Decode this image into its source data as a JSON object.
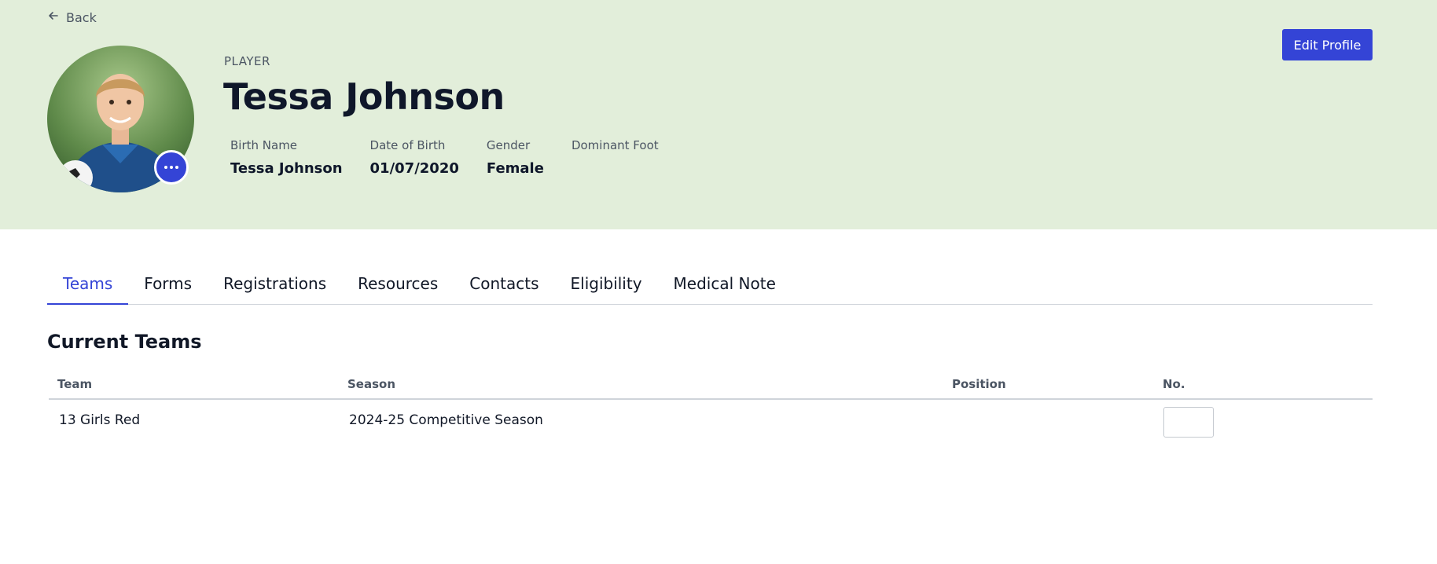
{
  "nav": {
    "back_label": "Back"
  },
  "profile": {
    "role": "PLAYER",
    "name": "Tessa Johnson",
    "edit_label": "Edit Profile",
    "facts": [
      {
        "label": "Birth Name",
        "value": "Tessa Johnson"
      },
      {
        "label": "Date of Birth",
        "value": "01/07/2020"
      },
      {
        "label": "Gender",
        "value": "Female"
      },
      {
        "label": "Dominant Foot",
        "value": ""
      }
    ]
  },
  "tabs": [
    {
      "label": "Teams",
      "active": true
    },
    {
      "label": "Forms"
    },
    {
      "label": "Registrations"
    },
    {
      "label": "Resources"
    },
    {
      "label": "Contacts"
    },
    {
      "label": "Eligibility"
    },
    {
      "label": "Medical Note"
    }
  ],
  "current_teams": {
    "title": "Current Teams",
    "headers": {
      "team": "Team",
      "season": "Season",
      "position": "Position",
      "number": "No."
    },
    "rows": [
      {
        "team": "13 Girls Red",
        "season": "2024-25 Competitive Season",
        "position": "",
        "number": ""
      }
    ]
  },
  "colors": {
    "accent": "#3444d6",
    "hero_bg": "#e2eeda"
  },
  "icons": {
    "back": "arrow-left-icon",
    "more": "more-horizontal-icon"
  }
}
